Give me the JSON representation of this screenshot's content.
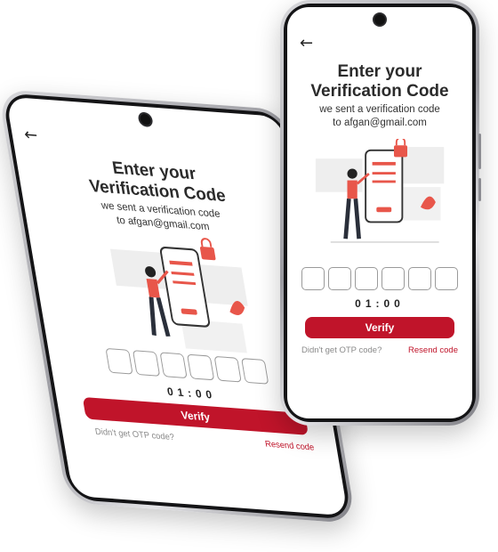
{
  "screen": {
    "back_icon": "arrow-left-icon",
    "title_line1": "Enter your",
    "title_line2": "Verification Code",
    "subtitle_line1": "we sent a verification code",
    "subtitle_line2": "to afgan@gmail.com",
    "otp_boxes": [
      "",
      "",
      "",
      "",
      "",
      ""
    ],
    "timer": "01:00",
    "verify_label": "Verify",
    "no_code_text": "Didn't get OTP code?",
    "resend_label": "Resend code"
  },
  "colors": {
    "accent": "#c0142a",
    "illustration_accent": "#e8564a",
    "text_dark": "#2b2b2b"
  }
}
